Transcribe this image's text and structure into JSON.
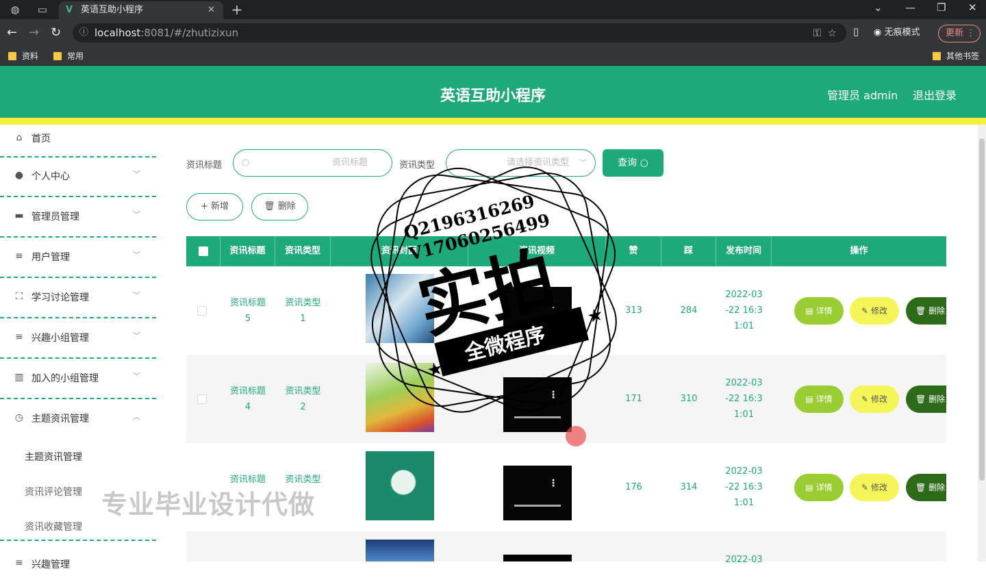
{
  "browser": {
    "tab_title": "英语互助小程序",
    "url_host": "localhost",
    "url_rest": ":8081/#/zhutizixun",
    "incognito_label": "无痕模式",
    "update_label": "更新",
    "bookmarks": [
      "资料",
      "常用"
    ],
    "other_bookmarks": "其他书签"
  },
  "header": {
    "title": "英语互助小程序",
    "user": "管理员 admin",
    "logout": "退出登录"
  },
  "sidebar": {
    "items": [
      {
        "label": "首页"
      },
      {
        "label": "个人中心"
      },
      {
        "label": "管理员管理"
      },
      {
        "label": "用户管理"
      },
      {
        "label": "学习讨论管理"
      },
      {
        "label": "兴趣小组管理"
      },
      {
        "label": "加入的小组管理"
      },
      {
        "label": "主题资讯管理"
      }
    ],
    "sub_items": [
      "主题资讯管理",
      "资讯评论管理",
      "资讯收藏管理"
    ],
    "last_label": "兴趣管理"
  },
  "filters": {
    "title_label": "资讯标题",
    "title_placeholder": "资讯标题",
    "type_label": "资讯类型",
    "type_placeholder": "请选择资讯类型",
    "query_button": "查询",
    "add_button": "新增",
    "delete_button": "删除"
  },
  "table": {
    "headers": [
      "资讯标题",
      "资讯类型",
      "资讯封面",
      "资讯视频",
      "赞",
      "踩",
      "发布时间",
      "操作"
    ],
    "rows": [
      {
        "title_a": "资讯标题",
        "title_b": "5",
        "type_a": "资讯类型",
        "type_b": "1",
        "likes": "313",
        "dislikes": "284",
        "time_1": "2022-03",
        "time_2": "-22 16:3",
        "time_3": "1:01"
      },
      {
        "title_a": "资讯标题",
        "title_b": "4",
        "type_a": "资讯类型",
        "type_b": "2",
        "likes": "171",
        "dislikes": "310",
        "time_1": "2022-03",
        "time_2": "-22 16:3",
        "time_3": "1:01"
      },
      {
        "title_a": "资讯标题",
        "title_b": "",
        "type_a": "资讯类型",
        "type_b": "",
        "likes": "176",
        "dislikes": "314",
        "time_1": "2022-03",
        "time_2": "-22 16:3",
        "time_3": "1:01"
      },
      {
        "title_a": "",
        "title_b": "",
        "type_a": "",
        "type_b": "",
        "likes": "",
        "dislikes": "",
        "time_1": "2022-03",
        "time_2": "",
        "time_3": ""
      }
    ],
    "actions": {
      "detail": "详情",
      "edit": "修改",
      "delete": "删除"
    }
  },
  "overlay": {
    "watermark": "专业毕业设计代做",
    "stamp_line1": "Q2196316269",
    "stamp_line2": "V17060256499",
    "stamp_big": "实拍",
    "stamp_ribbon": "全微程序"
  },
  "colors": {
    "primary": "#1ea97a",
    "accent_yellow": "#f4f13a",
    "detail_green": "#9acd32",
    "edit_yellow": "#f5f55a",
    "delete_dark": "#2d6a1a"
  }
}
